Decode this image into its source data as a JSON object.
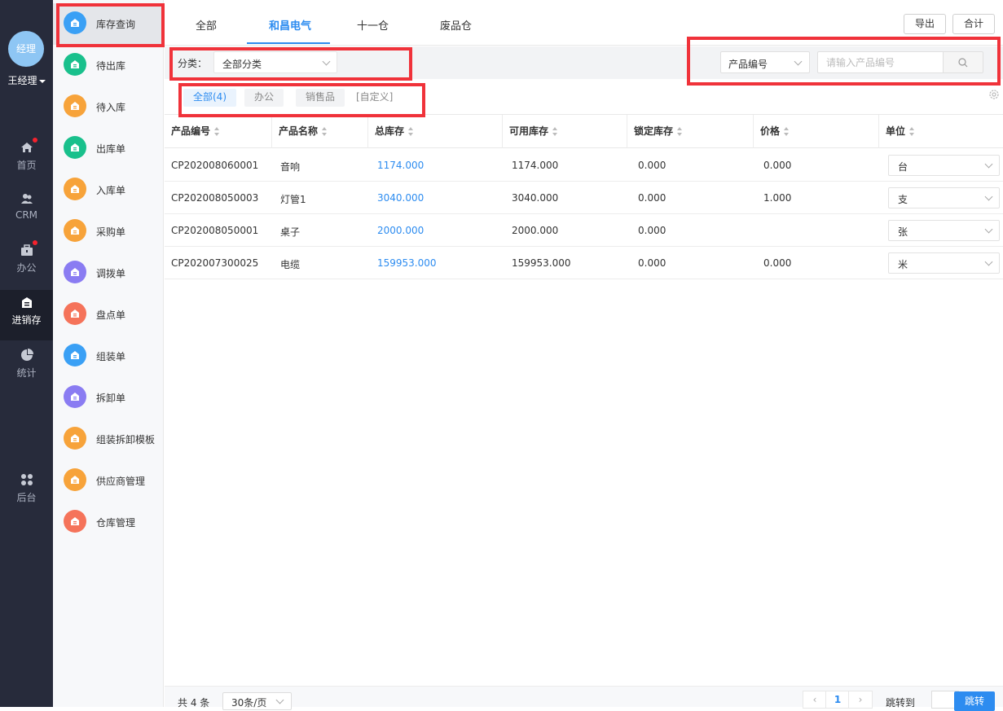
{
  "nav": {
    "avatar_text": "经理",
    "user_name": "王经理",
    "items": [
      {
        "label": "首页",
        "icon": "home-icon",
        "badge": true
      },
      {
        "label": "CRM",
        "icon": "users-icon",
        "badge": false
      },
      {
        "label": "办公",
        "icon": "briefcase-icon",
        "badge": true
      },
      {
        "label": "进销存",
        "icon": "warehouse-icon",
        "badge": false,
        "active": true
      },
      {
        "label": "统计",
        "icon": "pie-chart-icon",
        "badge": false
      },
      {
        "label": "后台",
        "icon": "grid-icon",
        "badge": false
      }
    ]
  },
  "submenu": {
    "items": [
      {
        "label": "库存查询",
        "color": "#3aa0f5",
        "active": true
      },
      {
        "label": "待出库",
        "color": "#19c08c"
      },
      {
        "label": "待入库",
        "color": "#f7a33a"
      },
      {
        "label": "出库单",
        "color": "#19c08c"
      },
      {
        "label": "入库单",
        "color": "#f7a33a"
      },
      {
        "label": "采购单",
        "color": "#f7a33a"
      },
      {
        "label": "调拨单",
        "color": "#8a7cf2"
      },
      {
        "label": "盘点单",
        "color": "#f5735a"
      },
      {
        "label": "组装单",
        "color": "#3aa0f5"
      },
      {
        "label": "拆卸单",
        "color": "#8a7cf2"
      },
      {
        "label": "组装拆卸模板",
        "color": "#f7a33a"
      },
      {
        "label": "供应商管理",
        "color": "#f7a33a"
      },
      {
        "label": "仓库管理",
        "color": "#f5735a"
      }
    ]
  },
  "tabs": [
    "全部",
    "和昌电气",
    "十一仓",
    "废品仓"
  ],
  "active_tab": "和昌电气",
  "toolbar": {
    "export_label": "导出",
    "total_label": "合计"
  },
  "filter": {
    "category_label": "分类：",
    "category_value": "全部分类",
    "field_select": "产品编号",
    "search_placeholder": "请输入产品编号"
  },
  "chips": [
    "全部(4)",
    "办公",
    "销售品",
    "[自定义]"
  ],
  "table": {
    "columns": [
      "产品编号",
      "产品名称",
      "总库存",
      "可用库存",
      "锁定库存",
      "价格",
      "单位"
    ],
    "rows": [
      {
        "code": "CP202008060001",
        "name": "音响",
        "total": "1174.000",
        "available": "1174.000",
        "locked": "0.000",
        "price": "0.000",
        "unit": "台"
      },
      {
        "code": "CP202008050003",
        "name": "灯管1",
        "total": "3040.000",
        "available": "3040.000",
        "locked": "0.000",
        "price": "1.000",
        "unit": "支"
      },
      {
        "code": "CP202008050001",
        "name": "桌子",
        "total": "2000.000",
        "available": "2000.000",
        "locked": "0.000",
        "price": "",
        "unit": "张"
      },
      {
        "code": "CP202007300025",
        "name": "电缆",
        "total": "159953.000",
        "available": "159953.000",
        "locked": "0.000",
        "price": "0.000",
        "unit": "米"
      }
    ]
  },
  "footer": {
    "total_text": "共 4 条",
    "page_size": "30条/页",
    "current_page": "1",
    "jump_label": "跳转到",
    "jump_button": "跳转"
  },
  "colors": {
    "accent": "#2d8cf0",
    "annotation": "#f0323a",
    "nav_bg": "#272b3b"
  }
}
